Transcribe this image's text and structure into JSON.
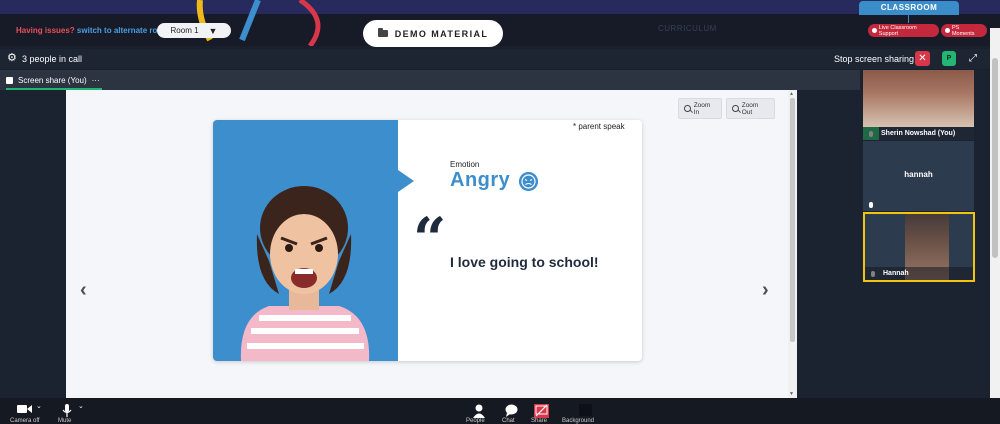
{
  "header": {
    "issue_prefix": "Having issues?",
    "issue_link": "switch to alternate room",
    "room_select": "Room 1",
    "demo_button": "DEMO MATERIAL",
    "curriculum": "CURRICULUM",
    "classroom_tab": "CLASSROOM",
    "live_support": "Live Classroom Support",
    "ps_moments": "PS Moments"
  },
  "call": {
    "people_count": "3 people in call",
    "stop_sharing": "Stop screen sharing",
    "p_label": "P",
    "close_glyph": "✕",
    "expand_glyph": "⤢",
    "gear_glyph": "⚙"
  },
  "tabs": {
    "screen_share": "Screen share (You)",
    "more": "···"
  },
  "viewer": {
    "zoom_in": "Zoom In",
    "zoom_out": "Zoom Out",
    "prev_glyph": "‹",
    "next_glyph": "›",
    "scroll_up": "▲",
    "scroll_down": "▼"
  },
  "slide": {
    "note": "* parent speak",
    "emotion_label": "Emotion",
    "emotion_word": "Angry",
    "quote_mark": "“",
    "quote": "I love going to school!"
  },
  "participants": [
    {
      "name": "Sherin Nowshad (You)"
    },
    {
      "name": "hannah"
    },
    {
      "name": "Hannah"
    }
  ],
  "bottom": {
    "camera_label": "Camera off",
    "mic_label": "Mute",
    "people_label": "People",
    "chat_label": "Chat",
    "share_label": "Share",
    "bg_label": "Background",
    "caret": "⌄"
  }
}
